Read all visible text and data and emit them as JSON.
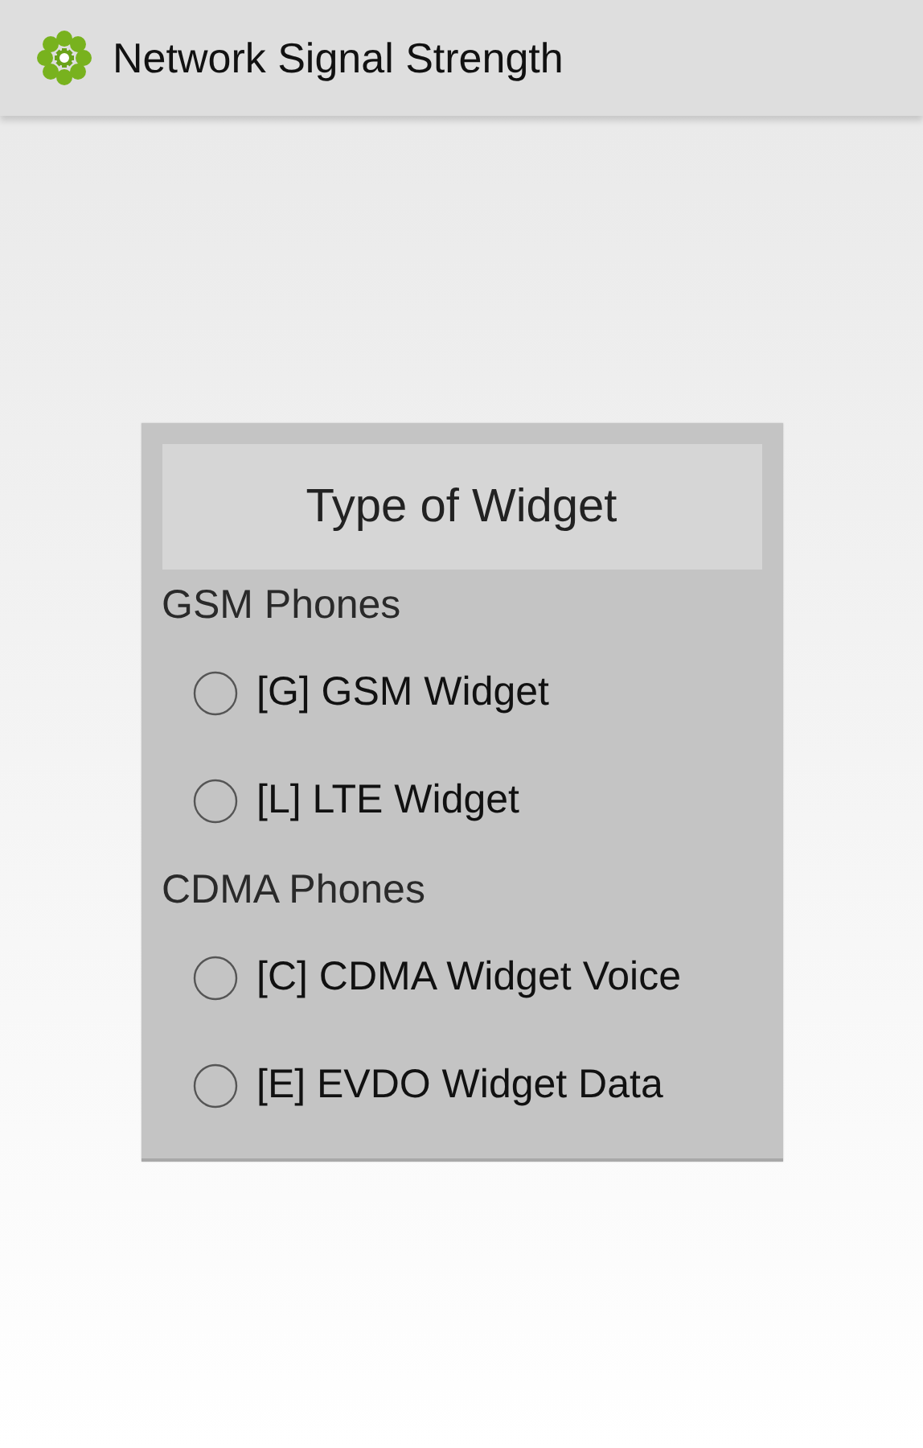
{
  "app_bar": {
    "title": "Network Signal Strength"
  },
  "dialog": {
    "title": "Type of Widget",
    "sections": [
      {
        "heading": "GSM Phones",
        "options": [
          {
            "label": "[G] GSM Widget",
            "selected": false
          },
          {
            "label": "[L] LTE Widget",
            "selected": false
          }
        ]
      },
      {
        "heading": "CDMA Phones",
        "options": [
          {
            "label": "[C] CDMA Widget Voice",
            "selected": false
          },
          {
            "label": "[E] EVDO Widget Data",
            "selected": false
          }
        ]
      }
    ]
  }
}
